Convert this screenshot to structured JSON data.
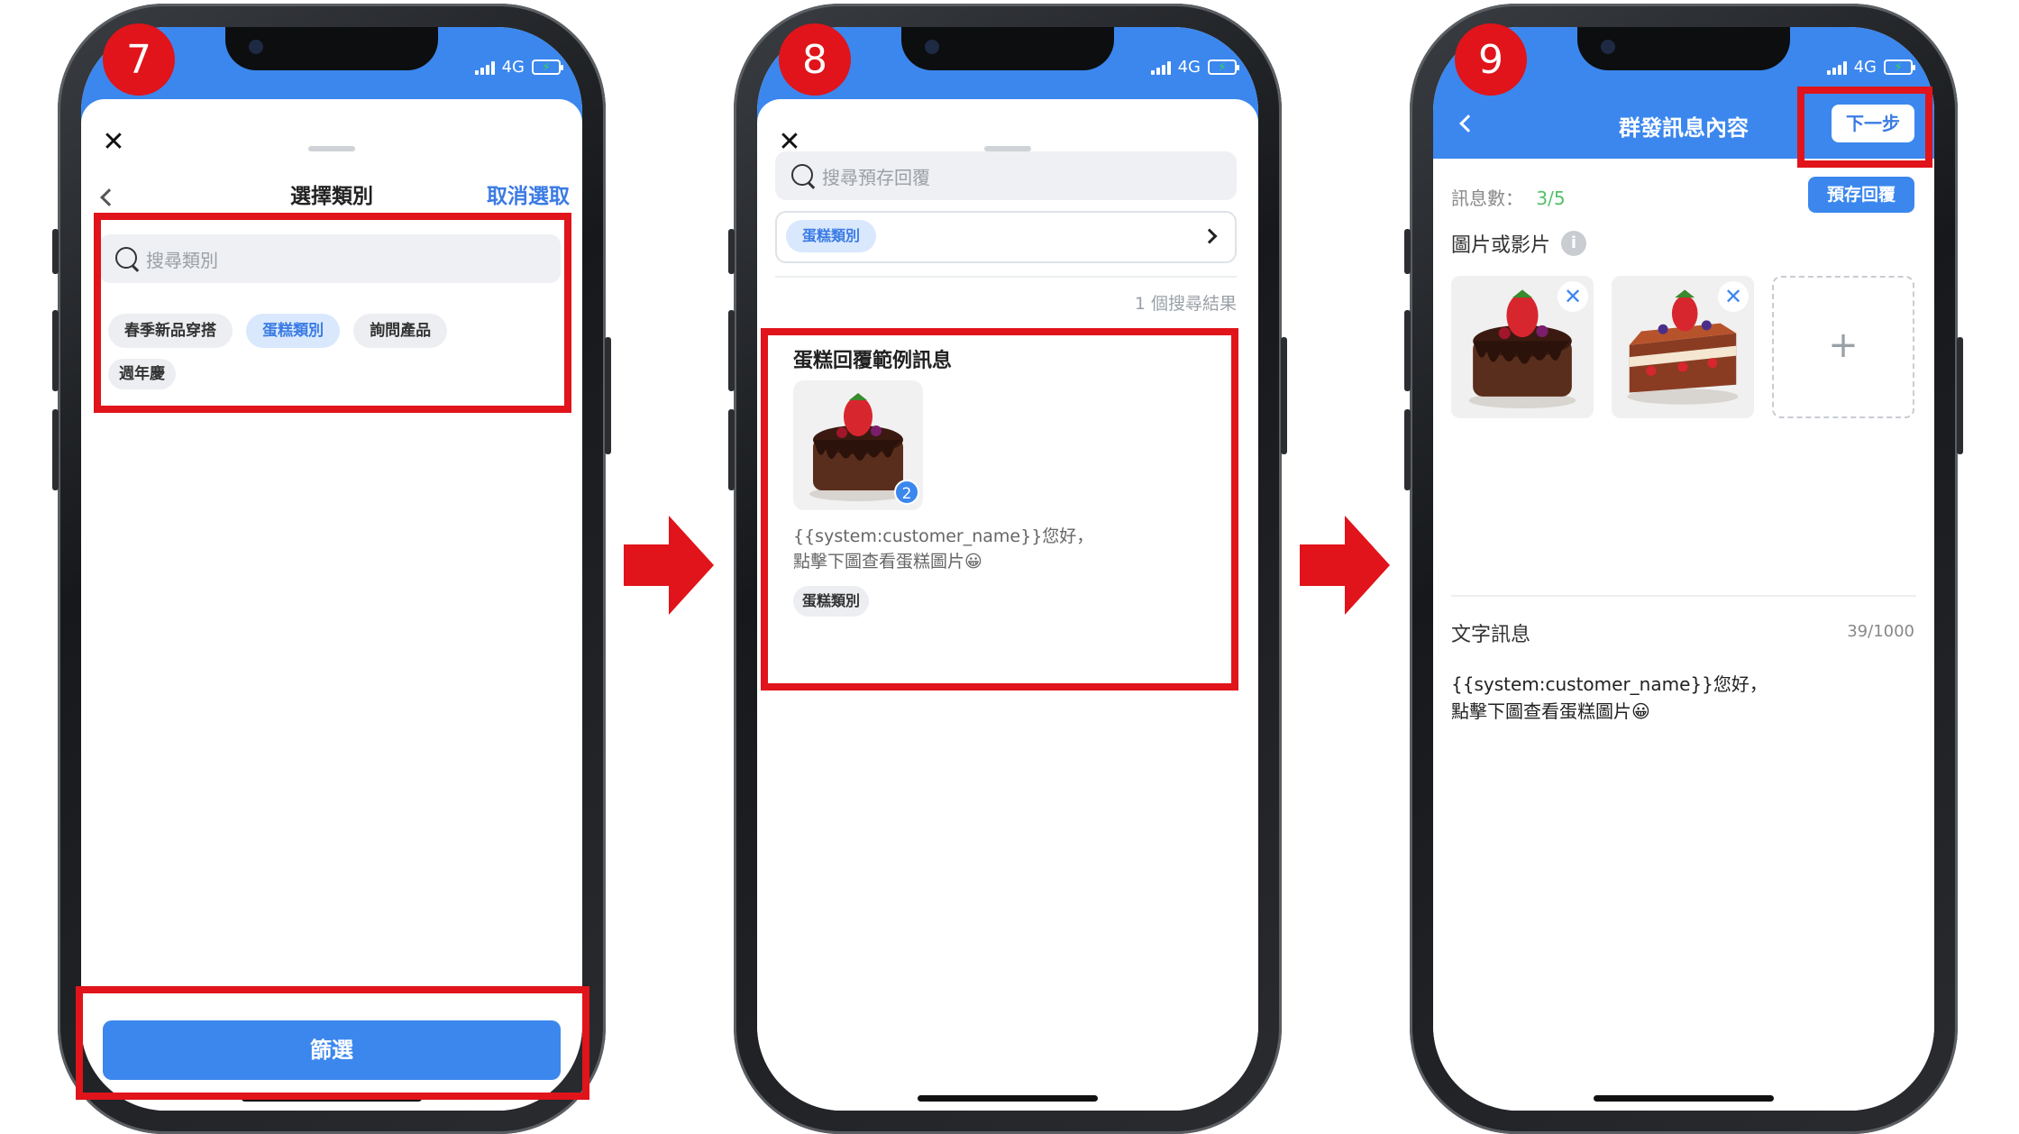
{
  "status": {
    "network": "4G"
  },
  "colors": {
    "primary": "#3b87ee",
    "highlight": "#e0141a",
    "accent_green": "#55c06a"
  },
  "screens": [
    {
      "step": "7",
      "close_label": "✕",
      "header": {
        "title": "選擇類別",
        "action": "取消選取"
      },
      "search_placeholder": "搜尋類別",
      "chips": [
        "春季新品穿搭",
        "蛋糕類別",
        "詢問產品",
        "週年慶"
      ],
      "selected_chip": "蛋糕類別",
      "filter_button": "篩選"
    },
    {
      "step": "8",
      "close_label": "✕",
      "search_placeholder": "搜尋預存回覆",
      "filter_chip": "蛋糕類別",
      "result_count": "1 個搜尋結果",
      "card": {
        "title": "蛋糕回覆範例訊息",
        "image_count": "2",
        "line1": "{{system:customer_name}}您好，",
        "line2": "點擊下圖查看蛋糕圖片😀",
        "tag": "蛋糕類別"
      }
    },
    {
      "step": "9",
      "header": {
        "title": "群發訊息內容",
        "next": "下一步"
      },
      "message_count_label": "訊息數：",
      "message_count": "3/5",
      "saved_reply_button": "預存回覆",
      "media_label": "圖片或影片",
      "add_label": "+",
      "text_section_label": "文字訊息",
      "char_count": "39/1000",
      "line1": "{{system:customer_name}}您好，",
      "line2": "點擊下圖查看蛋糕圖片😀"
    }
  ]
}
